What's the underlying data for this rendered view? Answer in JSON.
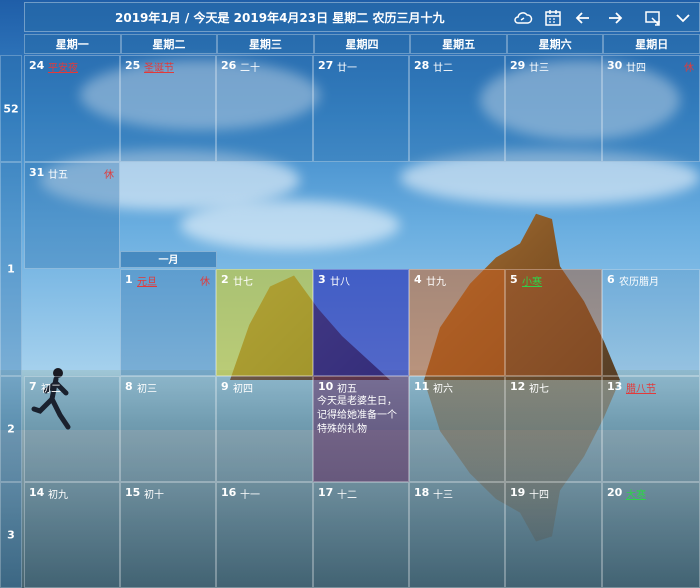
{
  "header": {
    "title": "2019年1月 / 今天是 2019年4月23日 星期二 农历三月十九",
    "icons": [
      "cloud-sync-icon",
      "calendar-icon",
      "arrow-left-icon",
      "arrow-right-icon",
      "window-icon",
      "chevron-down-icon"
    ]
  },
  "weekdays": [
    "星期一",
    "星期二",
    "星期三",
    "星期四",
    "星期五",
    "星期六",
    "星期日"
  ],
  "month_label": "一月",
  "weeks": [
    {
      "num": "52",
      "days": [
        {
          "d": "24",
          "lunar": "平安夜",
          "holiday": true,
          "lunarColor": "#e23a3a"
        },
        {
          "d": "25",
          "lunar": "圣诞节",
          "holiday": true,
          "lunarColor": "#e23a3a"
        },
        {
          "d": "26",
          "lunar": "二十"
        },
        {
          "d": "27",
          "lunar": "廿一"
        },
        {
          "d": "28",
          "lunar": "廿二"
        },
        {
          "d": "29",
          "lunar": "廿三"
        },
        {
          "d": "30",
          "lunar": "廿四",
          "rest": "休"
        }
      ]
    },
    {
      "num": "1",
      "days": [
        {
          "d": "31",
          "lunar": "廿五",
          "rest": "休"
        },
        {
          "d": "1",
          "lunar": "元旦",
          "holiday": true,
          "lunarColor": "#e23a3a",
          "rest": "休"
        },
        {
          "d": "2",
          "lunar": "廿七"
        },
        {
          "d": "3",
          "lunar": "廿八"
        },
        {
          "d": "4",
          "lunar": "廿九"
        },
        {
          "d": "5",
          "lunar": "小寒",
          "holiday": true,
          "lunarColor": "#2fd24a"
        },
        {
          "d": "6",
          "lunar": "农历腊月"
        }
      ]
    },
    {
      "num": "2",
      "days": [
        {
          "d": "7",
          "lunar": "初二"
        },
        {
          "d": "8",
          "lunar": "初三"
        },
        {
          "d": "9",
          "lunar": "初四"
        },
        {
          "d": "10",
          "lunar": "初五",
          "note": "今天是老婆生日，记得给她准备一个特殊的礼物"
        },
        {
          "d": "11",
          "lunar": "初六"
        },
        {
          "d": "12",
          "lunar": "初七"
        },
        {
          "d": "13",
          "lunar": "腊八节",
          "holiday": true,
          "lunarColor": "#e23a3a"
        }
      ]
    },
    {
      "num": "3",
      "days": [
        {
          "d": "14",
          "lunar": "初九"
        },
        {
          "d": "15",
          "lunar": "初十"
        },
        {
          "d": "16",
          "lunar": "十一"
        },
        {
          "d": "17",
          "lunar": "十二"
        },
        {
          "d": "18",
          "lunar": "十三"
        },
        {
          "d": "19",
          "lunar": "十四"
        },
        {
          "d": "20",
          "lunar": "大寒",
          "holiday": true,
          "lunarColor": "#2fd24a"
        }
      ]
    }
  ],
  "colors": {
    "highlight_jan2": "#c8c828",
    "highlight_jan3": "#1a22b0",
    "highlight_jan4": "#c86020",
    "highlight_jan5": "#a05830",
    "note_cell": "#5a2860",
    "holiday_red": "#e23a3a",
    "solar_term_green": "#2fd24a"
  }
}
